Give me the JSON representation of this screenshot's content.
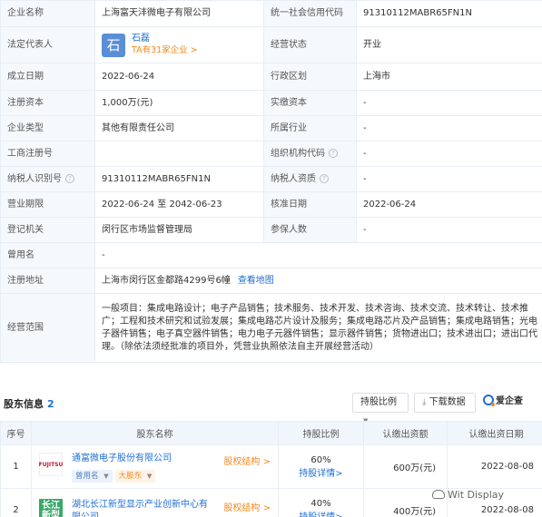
{
  "info": {
    "company_name_label": "企业名称",
    "company_name": "上海富天沣微电子有限公司",
    "credit_code_label": "统一社会信用代码",
    "credit_code": "91310112MABR65FN1N",
    "legal_rep_label": "法定代表人",
    "legal_rep_avatar": "石",
    "legal_rep_name": "石磊",
    "legal_rep_companies": "TA有31家企业 >",
    "status_label": "经营状态",
    "status": "开业",
    "founded_label": "成立日期",
    "founded": "2022-06-24",
    "region_label": "行政区划",
    "region": "上海市",
    "reg_capital_label": "注册资本",
    "reg_capital": "1,000万(元)",
    "paid_capital_label": "实缴资本",
    "paid_capital": "-",
    "type_label": "企业类型",
    "type": "其他有限责任公司",
    "industry_label": "所属行业",
    "industry": "-",
    "reg_no_label": "工商注册号",
    "reg_no": "",
    "org_code_label": "组织机构代码",
    "org_code": "-",
    "taxpayer_id_label": "纳税人识别号",
    "taxpayer_id": "91310112MABR65FN1N",
    "taxpayer_qual_label": "纳税人资质",
    "taxpayer_qual": "-",
    "term_label": "营业期限",
    "term": "2022-06-24 至 2042-06-23",
    "approval_label": "核准日期",
    "approval": "2022-06-24",
    "authority_label": "登记机关",
    "authority": "闵行区市场监督管理局",
    "insured_label": "参保人数",
    "insured": "-",
    "former_name_label": "曾用名",
    "former_name": "-",
    "address_label": "注册地址",
    "address": "上海市闵行区金都路4299号6幢",
    "map_link": "查看地图",
    "scope_label": "经营范围",
    "scope": "一般项目：集成电路设计；电子产品销售；技术服务、技术开发、技术咨询、技术交流、技术转让、技术推广；工程和技术研究和试验发展；集成电路芯片设计及服务；集成电路芯片及产品销售；集成电路销售；光电子器件销售；电子真空器件销售；电力电子元器件销售；显示器件销售；货物进出口；技术进出口；进出口代理。（除依法须经批准的项目外，凭营业执照依法自主开展经营活动）"
  },
  "shareholders": {
    "title": "股东信息",
    "count": "2",
    "btn_ratio": "持股比例",
    "btn_download": "下载数据",
    "btn_qcc": "爱企查",
    "columns": [
      "序号",
      "股东名称",
      "持股比例",
      "认缴出资额",
      "认缴出资日期"
    ],
    "rows": [
      {
        "index": "1",
        "logo": "FUJITSU",
        "name": "通富微电子股份有限公司",
        "tags": [
          "曾用名",
          "大股东"
        ],
        "equity_link": "股权结构 >",
        "percent": "60%",
        "detail": "持股详情>",
        "amount": "600万(元)",
        "date": "2022-08-08"
      },
      {
        "index": "2",
        "logo": "长江新型",
        "name": "湖北长江新型显示产业创新中心有限公司",
        "tags": [],
        "equity_link": "股权结构 >",
        "percent": "40%",
        "detail": "持股详情>",
        "amount": "400万(元)",
        "date": "2022-08-08"
      }
    ]
  },
  "watermark": "Wit Display"
}
